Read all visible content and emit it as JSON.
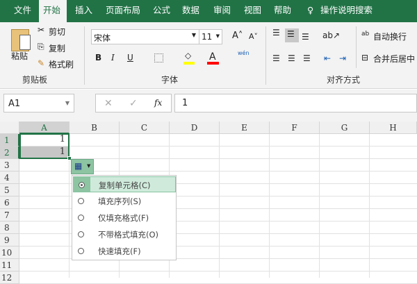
{
  "tabs": [
    "文件",
    "开始",
    "插入",
    "页面布局",
    "公式",
    "数据",
    "审阅",
    "视图",
    "帮助"
  ],
  "active_tab": "开始",
  "tell_me": "操作说明搜索",
  "clipboard": {
    "paste": "粘贴",
    "cut": "剪切",
    "copy": "复制",
    "format_painter": "格式刷",
    "group": "剪贴板"
  },
  "font": {
    "name": "宋体",
    "size": "11",
    "bold": "B",
    "italic": "I",
    "underline": "U",
    "font_color": "A",
    "phonetic": "wén",
    "group": "字体",
    "fill_color": "#ffff00",
    "text_color": "#ff0000"
  },
  "alignment": {
    "wrap": "自动换行",
    "merge": "合并后居中",
    "group": "对齐方式"
  },
  "formula_bar": {
    "name_box": "A1",
    "cancel": "✕",
    "enter": "✓",
    "fx": "fx",
    "value": "1"
  },
  "columns": [
    "A",
    "B",
    "C",
    "D",
    "E",
    "F",
    "G",
    "H"
  ],
  "rows": [
    "1",
    "2",
    "3",
    "4",
    "5",
    "6",
    "7",
    "8",
    "9",
    "10",
    "11",
    "12"
  ],
  "cells": {
    "A1": "1",
    "A2": "1"
  },
  "autofill_menu": {
    "items": [
      "复制单元格(C)",
      "填充序列(S)",
      "仅填充格式(F)",
      "不带格式填充(O)",
      "快速填充(F)"
    ],
    "selected": 0
  },
  "colors": {
    "accent": "#217346",
    "selection": "#cfeadb"
  }
}
